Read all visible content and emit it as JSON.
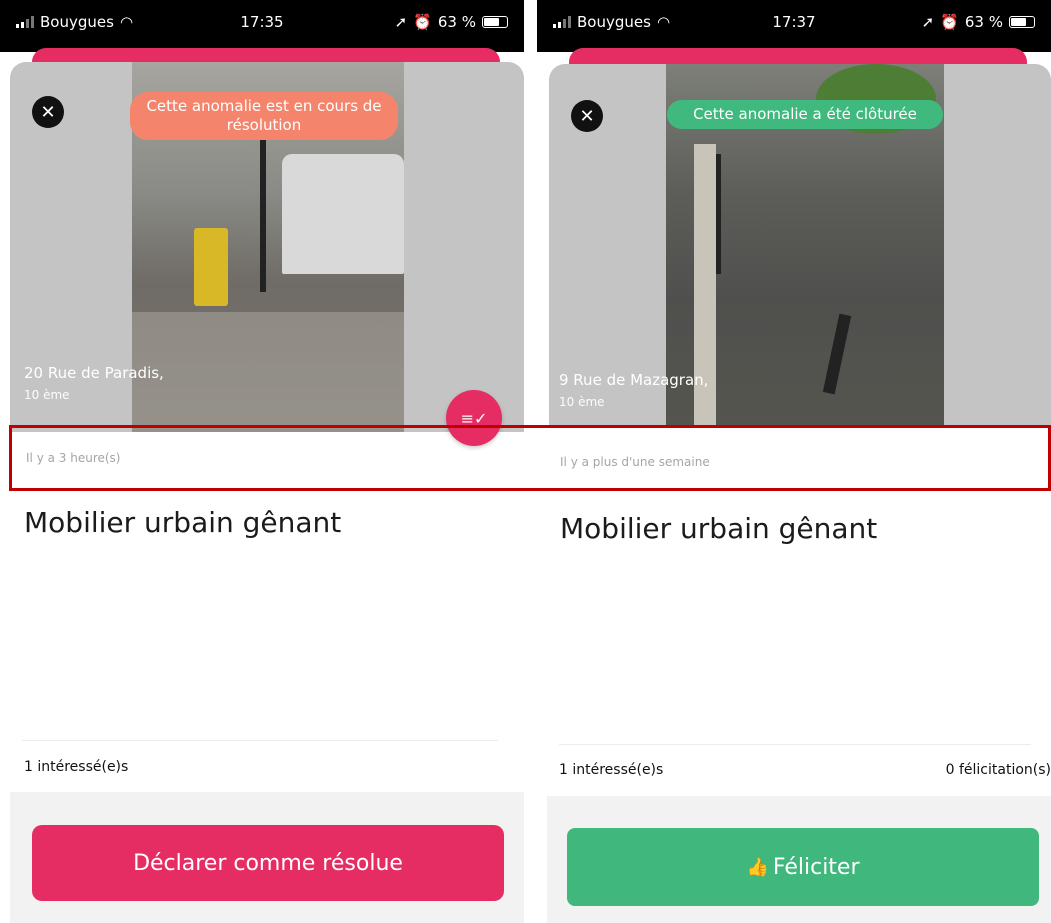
{
  "left": {
    "status": {
      "carrier": "Bouygues",
      "time": "17:35",
      "battery": "63 %"
    },
    "banner": "Cette anomalie est en cours de résolution",
    "address": {
      "street": "20 Rue de Paradis,",
      "district": "10 ème"
    },
    "time_ago": "Il y a 3 heure(s)",
    "title": "Mobilier urbain gênant",
    "interested": "1 intéressé(e)s",
    "action_label": "Déclarer comme résolue"
  },
  "right": {
    "status": {
      "carrier": "Bouygues",
      "time": "17:37",
      "battery": "63 %"
    },
    "banner": "Cette anomalie a été clôturée",
    "address": {
      "street": "9 Rue de Mazagran,",
      "district": "10 ème"
    },
    "time_ago": "Il y a plus d'une semaine",
    "title": "Mobilier urbain gênant",
    "interested": "1 intéressé(e)s",
    "congrats": "0 félicitation(s)",
    "action_label": "Féliciter"
  },
  "icons": {
    "close": "close-icon",
    "fab": "list-check-icon",
    "thumbs_up": "thumbs-up-icon",
    "wifi": "wifi-icon",
    "location": "location-arrow-icon",
    "alarm": "alarm-icon",
    "battery": "battery-icon"
  },
  "colors": {
    "accent_pink": "#e62d63",
    "in_progress_orange": "#f4856c",
    "closed_green": "#3fb97d",
    "highlight_red": "#c00000"
  }
}
